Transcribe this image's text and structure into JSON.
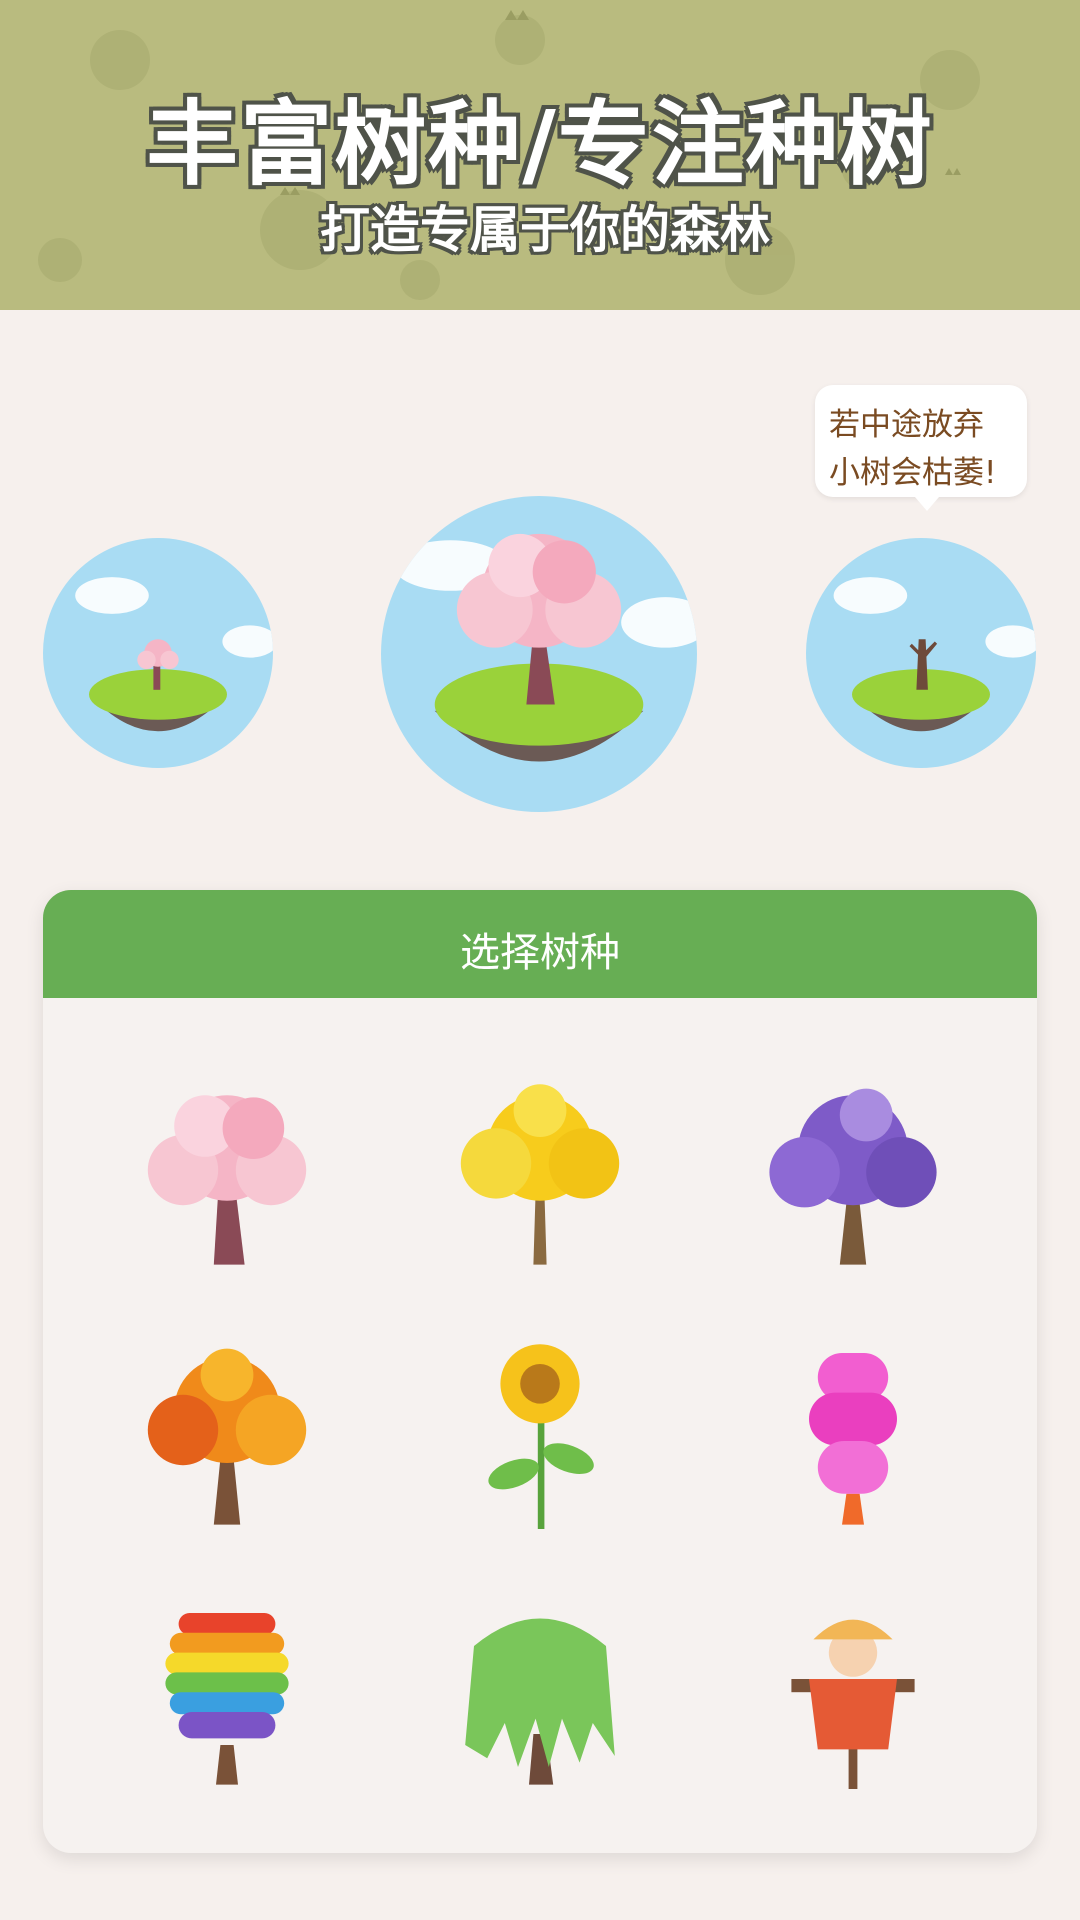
{
  "header": {
    "title": "丰富树种/专注种树",
    "subtitle": "打造专属于你的森林",
    "background_color": "#b9bb7f"
  },
  "bubble": {
    "line1": "若中途放弃",
    "line2": "小树会枯萎!"
  },
  "stages": [
    {
      "name": "sapling-sprout",
      "icon": "small-blossom-island-icon"
    },
    {
      "name": "grown-tree",
      "icon": "cherry-blossom-island-icon"
    },
    {
      "name": "withered-tree",
      "icon": "dead-tree-island-icon"
    }
  ],
  "tree_panel": {
    "title": "选择树种",
    "header_color": "#67ae54",
    "trees": [
      {
        "name": "cherry-blossom",
        "icon": "cherry-blossom-tree-icon"
      },
      {
        "name": "golden-ginkgo",
        "icon": "yellow-tree-icon"
      },
      {
        "name": "purple-jacaranda",
        "icon": "purple-tree-icon"
      },
      {
        "name": "autumn-maple",
        "icon": "orange-tree-icon"
      },
      {
        "name": "sunflower",
        "icon": "sunflower-icon"
      },
      {
        "name": "candy-tree",
        "icon": "pink-candy-tree-icon"
      },
      {
        "name": "rainbow-tree",
        "icon": "rainbow-tree-icon"
      },
      {
        "name": "weeping-willow",
        "icon": "willow-tree-icon"
      },
      {
        "name": "scarecrow",
        "icon": "scarecrow-icon"
      }
    ]
  }
}
